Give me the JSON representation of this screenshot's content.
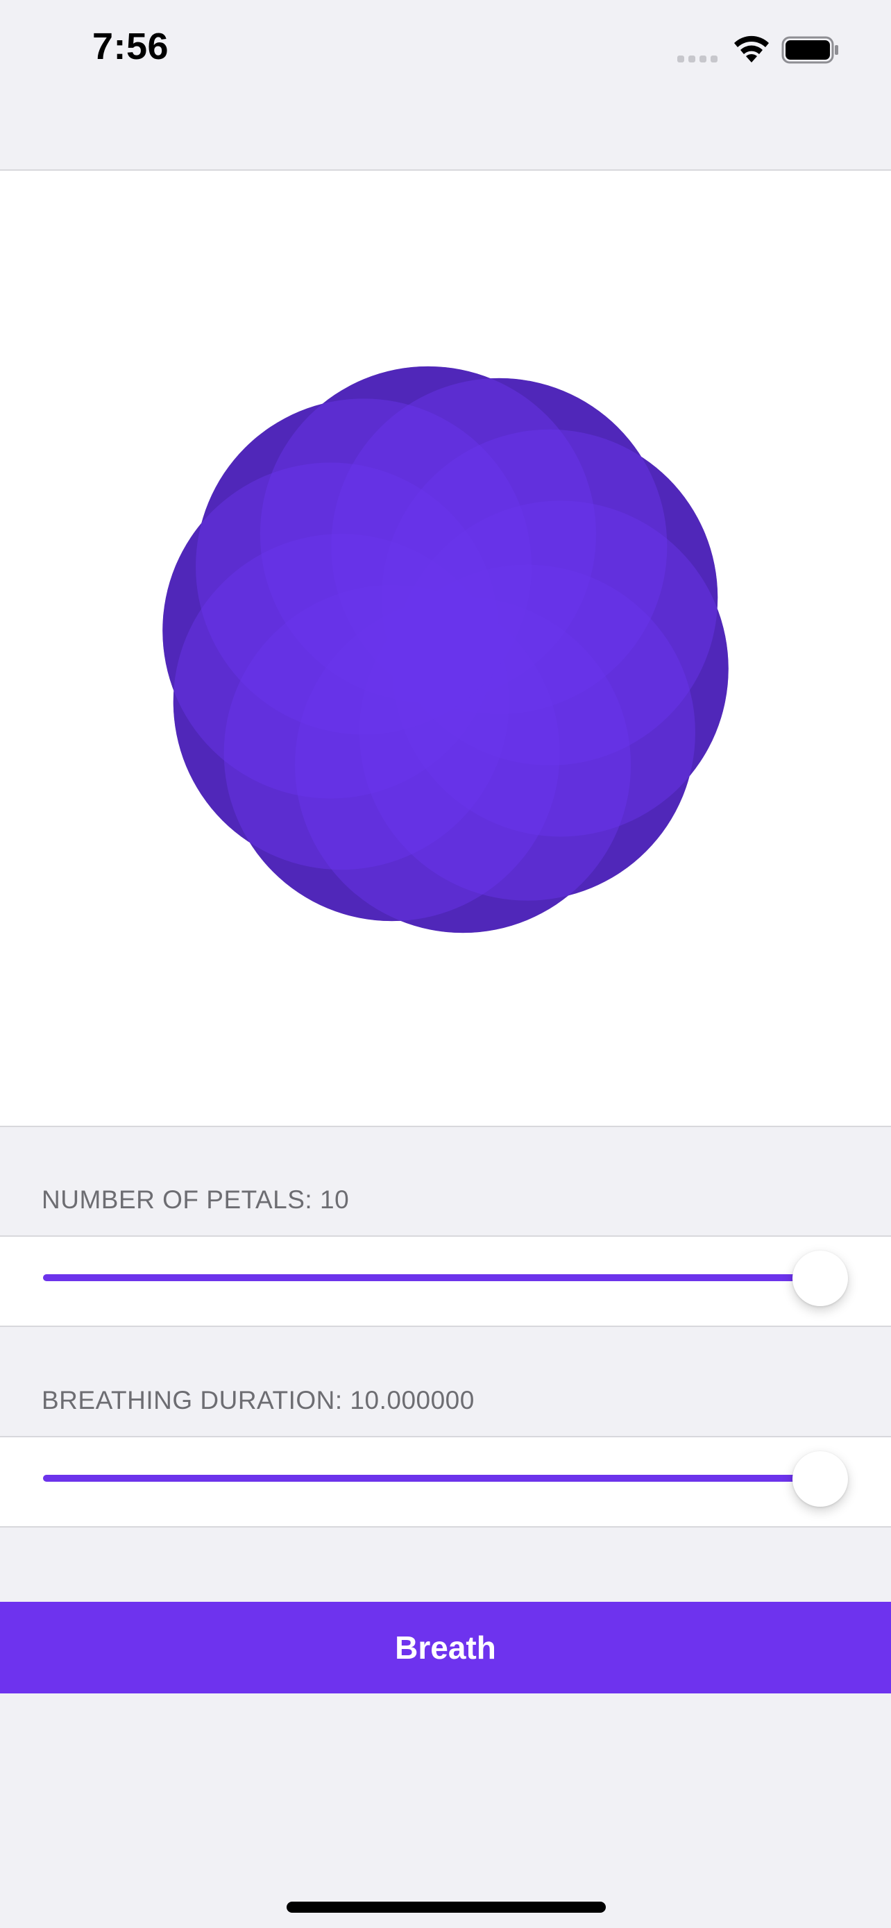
{
  "status_bar": {
    "time": "7:56",
    "icons": [
      "cellular-signal-icon",
      "wifi-icon",
      "battery-icon"
    ]
  },
  "flower": {
    "petal_count": 10,
    "colors": {
      "petal": "#6A35EE",
      "outer": "#3B1D8F"
    }
  },
  "petals_slider": {
    "label": "NUMBER OF PETALS: 10",
    "value": 10,
    "fraction": 1.0
  },
  "duration_slider": {
    "label": "BREATHING DURATION: 10.000000",
    "value": 10.0,
    "fraction": 1.0
  },
  "breath_button": {
    "label": "Breath"
  },
  "colors": {
    "accent": "#6E33EE",
    "background": "#F1F1F5",
    "section_text": "#6D6D72"
  }
}
